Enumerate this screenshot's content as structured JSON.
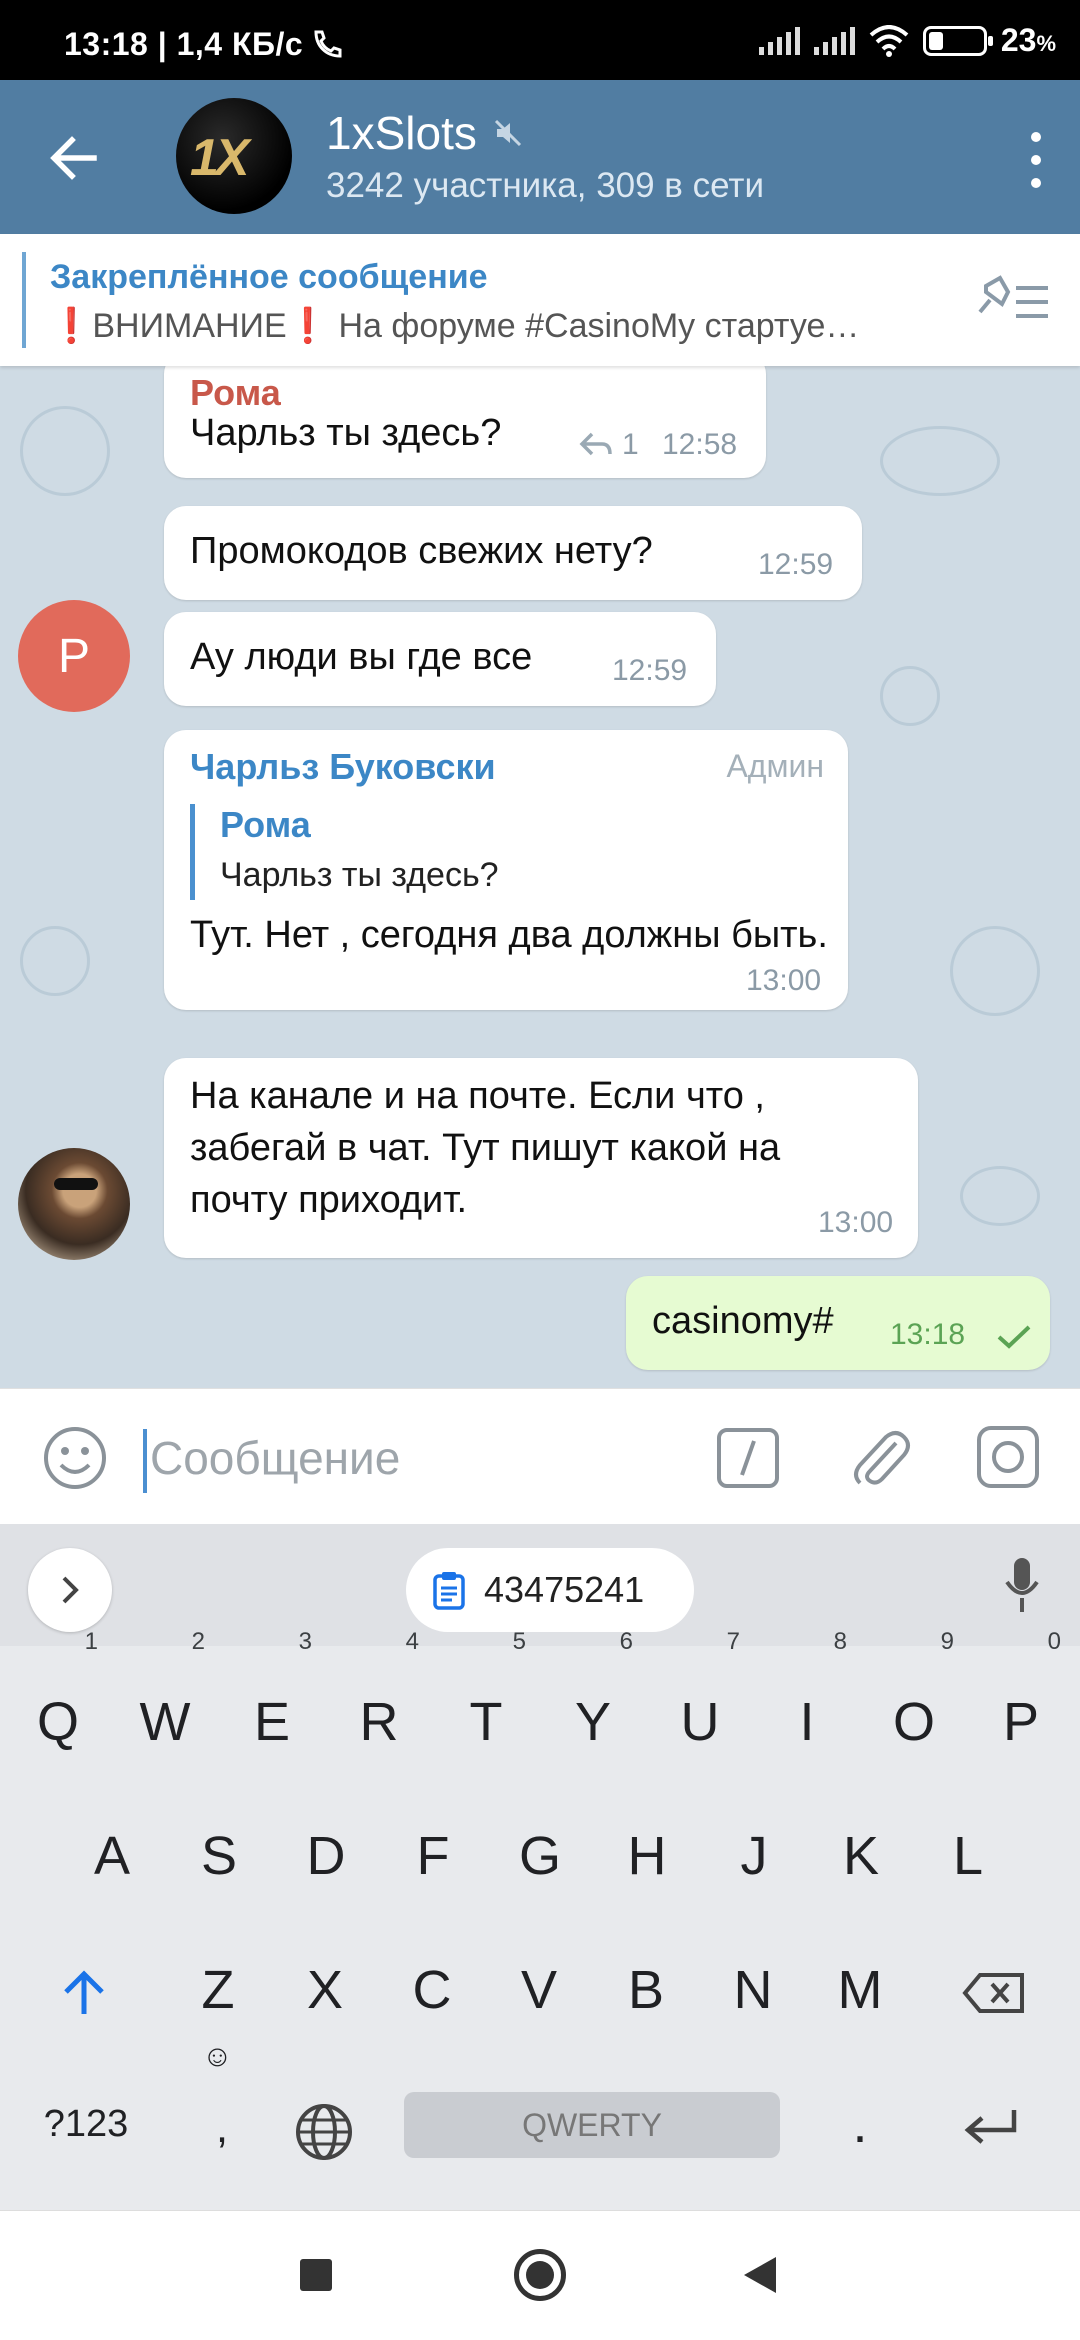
{
  "status_bar": {
    "time": "13:18 | 1,4 КБ/с",
    "battery": "23",
    "battery_unit": "%"
  },
  "header": {
    "avatar_text": "1X",
    "title": "1xSlots",
    "subtitle": "3242 участника, 309 в сети",
    "muted": true
  },
  "pinned": {
    "title": "Закреплённое сообщение",
    "text": "❗ВНИМАНИЕ❗ На форуме #CasinoMy стартуе…"
  },
  "messages": [
    {
      "sender": "Рома",
      "text": "Чарльз ты здесь?",
      "replies": "1",
      "time": "12:58"
    },
    {
      "text": "Промокодов свежих нету?",
      "time": "12:59"
    },
    {
      "text": "Ау люди вы где все",
      "time": "12:59",
      "avatar_letter": "Р"
    },
    {
      "sender": "Чарльз Буковски",
      "badge": "Админ",
      "reply_to_name": "Рома",
      "reply_to_text": "Чарльз ты здесь?",
      "text": "Тут. Нет , сегодня два должны быть.",
      "time": "13:00"
    },
    {
      "text": "На канале и на почте. Если что , забегай в чат. Тут пишут какой на почту приходит.",
      "time": "13:00"
    },
    {
      "text": "casinomy#",
      "time": "13:18",
      "outgoing": true,
      "read": true
    }
  ],
  "composer": {
    "placeholder": "Сообщение"
  },
  "keyboard": {
    "clipboard_chip": "43475241",
    "row1": [
      {
        "k": "Q",
        "n": "1"
      },
      {
        "k": "W",
        "n": "2"
      },
      {
        "k": "E",
        "n": "3"
      },
      {
        "k": "R",
        "n": "4"
      },
      {
        "k": "T",
        "n": "5"
      },
      {
        "k": "Y",
        "n": "6"
      },
      {
        "k": "U",
        "n": "7"
      },
      {
        "k": "I",
        "n": "8"
      },
      {
        "k": "O",
        "n": "9"
      },
      {
        "k": "P",
        "n": "0"
      }
    ],
    "row2": [
      "A",
      "S",
      "D",
      "F",
      "G",
      "H",
      "J",
      "K",
      "L"
    ],
    "row3": [
      "Z",
      "X",
      "C",
      "V",
      "B",
      "N",
      "M"
    ],
    "symbols_key": "?123",
    "comma_key": ",",
    "space_label": "QWERTY",
    "period_key": "."
  },
  "colors": {
    "header": "#517da2",
    "chat_bg": "#cfdbe4",
    "accent": "#3c87c6",
    "sender_roma": "#c8584a",
    "sender_admin": "#3c87c6",
    "outgoing_bubble": "#e6fbd2"
  }
}
